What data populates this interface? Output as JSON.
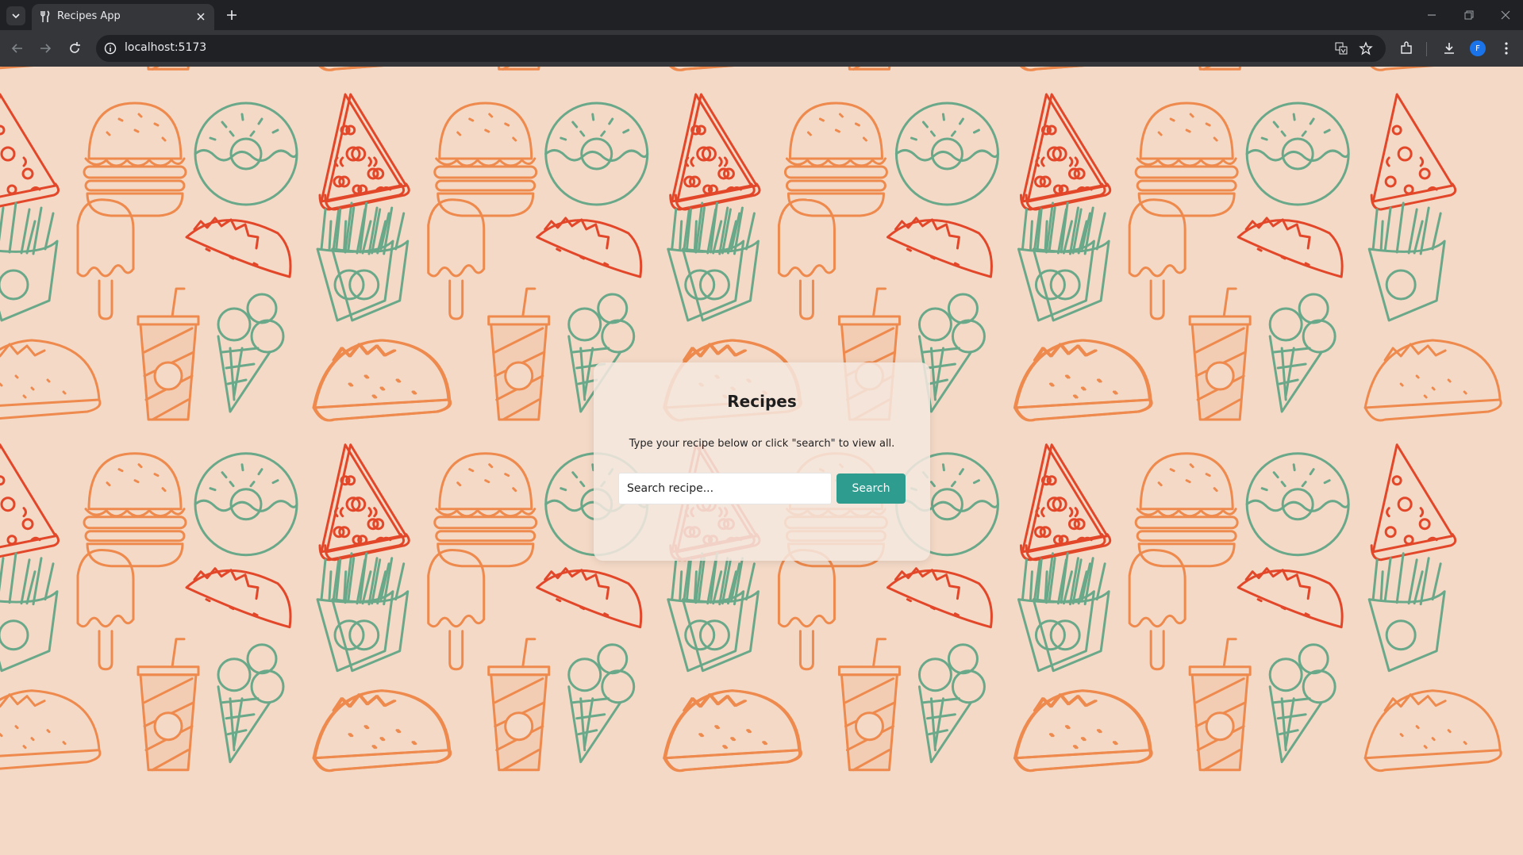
{
  "browser": {
    "tab_title": "Recipes App",
    "url": "localhost:5173",
    "profile_initial": "F"
  },
  "page": {
    "title": "Recipes",
    "subtitle": "Type your recipe below or click \"search\" to view all.",
    "search": {
      "placeholder": "Search recipe...",
      "value": "",
      "button_label": "Search"
    }
  },
  "colors": {
    "background": "#f4d9c6",
    "accent_orange": "#ee8a4d",
    "accent_red": "#e2472a",
    "accent_green": "#6aa88a",
    "button": "#2e9c8f"
  },
  "background_icons": [
    "burger-icon",
    "donut-icon",
    "pizza-icon",
    "fries-icon",
    "popsicle-icon",
    "taco-icon",
    "soda-cup-icon",
    "ice-cream-cone-icon"
  ]
}
